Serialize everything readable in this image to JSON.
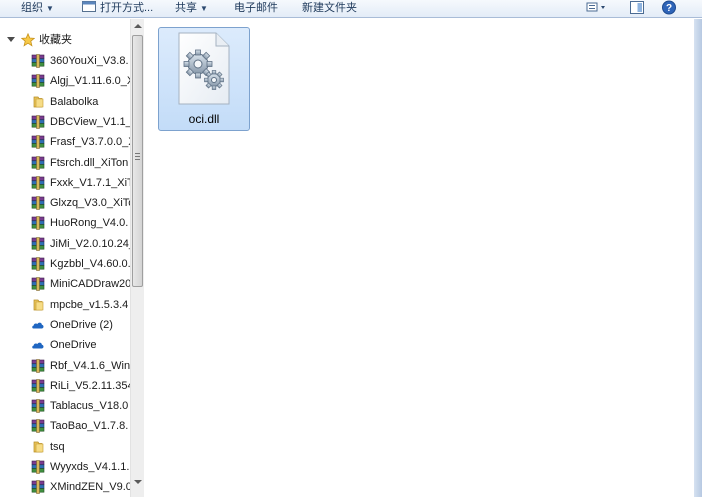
{
  "toolbar": {
    "organize": "组织",
    "open_with": "打开方式...",
    "share": "共享",
    "email": "电子邮件",
    "new_folder": "新建文件夹"
  },
  "nav": {
    "favorites": "收藏夹",
    "items": [
      {
        "label": "360YouXi_V3.8.",
        "icon": "rar-archive-icon"
      },
      {
        "label": "Algj_V1.11.6.0_X",
        "icon": "rar-archive-icon"
      },
      {
        "label": "Balabolka",
        "icon": "folder-icon"
      },
      {
        "label": "DBCView_V1.1_",
        "icon": "rar-archive-icon"
      },
      {
        "label": "Frasf_V3.7.0.0_X",
        "icon": "rar-archive-icon"
      },
      {
        "label": "Ftsrch.dll_XiTon",
        "icon": "rar-archive-icon"
      },
      {
        "label": "Fxxk_V1.7.1_XiT",
        "icon": "rar-archive-icon"
      },
      {
        "label": "Glxzq_V3.0_XiTo",
        "icon": "rar-archive-icon"
      },
      {
        "label": "HuoRong_V4.0.",
        "icon": "rar-archive-icon"
      },
      {
        "label": "JiMi_V2.0.10.24_",
        "icon": "rar-archive-icon"
      },
      {
        "label": "Kgzbbl_V4.60.0.",
        "icon": "rar-archive-icon"
      },
      {
        "label": "MiniCADDraw20",
        "icon": "rar-archive-icon"
      },
      {
        "label": "mpcbe_v1.5.3.4",
        "icon": "folder-icon"
      },
      {
        "label": "OneDrive (2)",
        "icon": "onedrive-cloud-icon"
      },
      {
        "label": "OneDrive",
        "icon": "onedrive-cloud-icon"
      },
      {
        "label": "Rbf_V4.1.6_Win",
        "icon": "rar-archive-icon"
      },
      {
        "label": "RiLi_V5.2.11.354",
        "icon": "rar-archive-icon"
      },
      {
        "label": "Tablacus_V18.0",
        "icon": "rar-archive-icon"
      },
      {
        "label": "TaoBao_V1.7.8.",
        "icon": "rar-archive-icon"
      },
      {
        "label": "tsq",
        "icon": "folder-icon"
      },
      {
        "label": "Wyyxds_V4.1.1.",
        "icon": "rar-archive-icon"
      },
      {
        "label": "XMindZEN_V9.0",
        "icon": "rar-archive-icon"
      }
    ]
  },
  "content": {
    "files": [
      {
        "name": "oci.dll",
        "icon": "dll-gear-file-icon",
        "selected": true
      }
    ]
  },
  "colors": {
    "selection_bg": "#cde3fb",
    "selection_border": "#7da2ce",
    "toolbar_bg": "#e3ecf7"
  }
}
